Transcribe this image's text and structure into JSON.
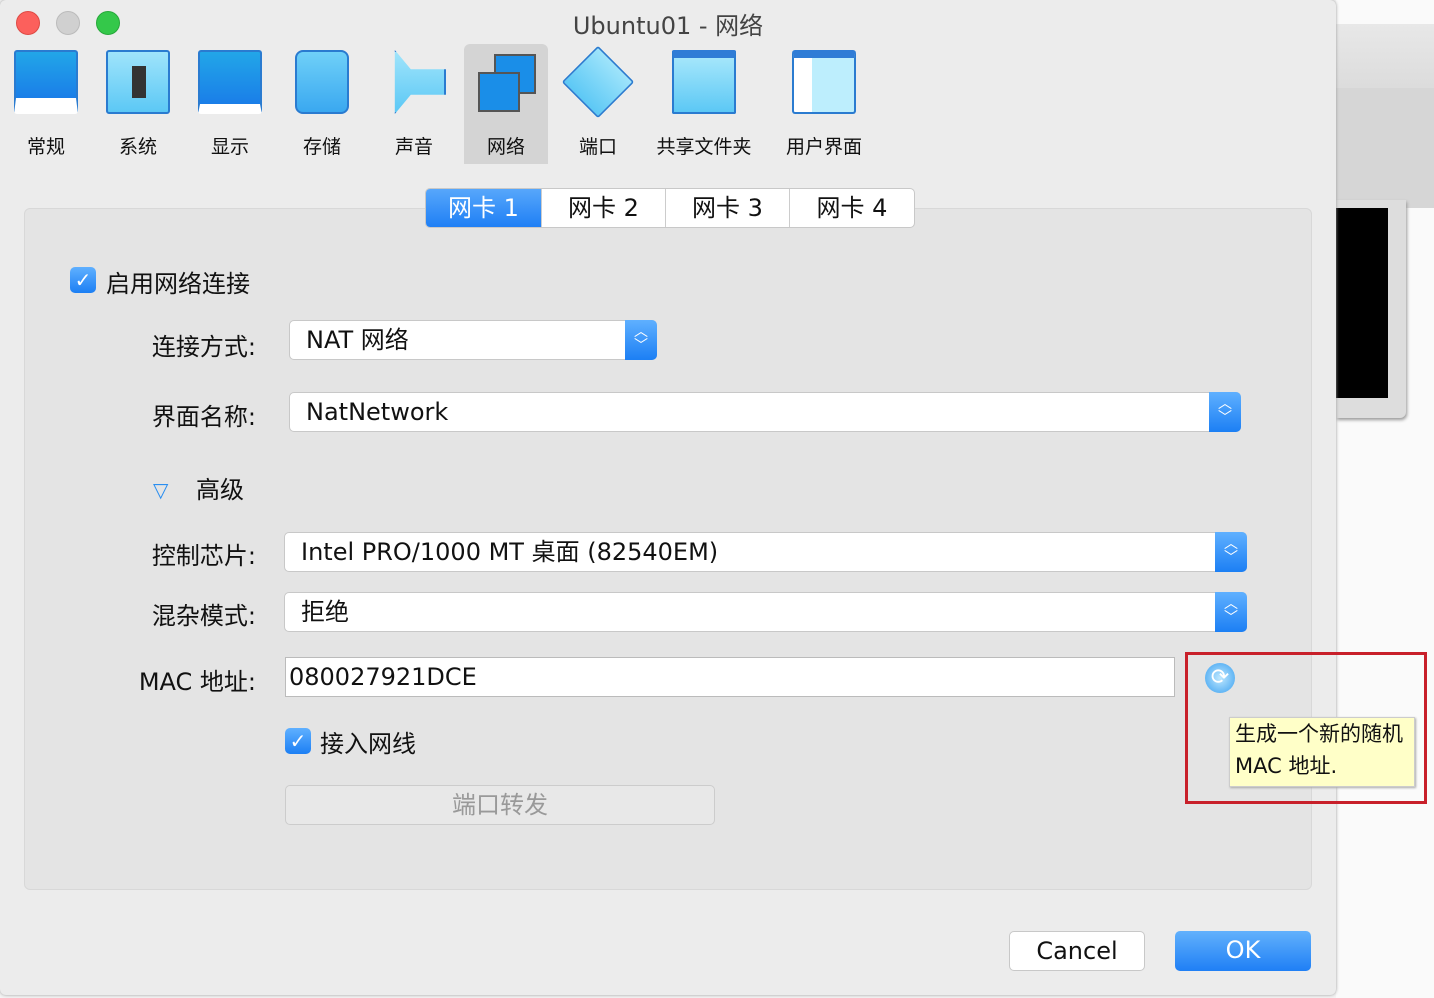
{
  "window": {
    "title": "Ubuntu01 - 网络"
  },
  "toolbar": [
    {
      "label": "常规",
      "icon": "general-icon"
    },
    {
      "label": "系统",
      "icon": "chip-icon"
    },
    {
      "label": "显示",
      "icon": "display-icon"
    },
    {
      "label": "存储",
      "icon": "disk-icon"
    },
    {
      "label": "声音",
      "icon": "speaker-icon"
    },
    {
      "label": "网络",
      "icon": "network-icon"
    },
    {
      "label": "端口",
      "icon": "port-icon"
    },
    {
      "label": "共享文件夹",
      "icon": "folder-icon"
    },
    {
      "label": "用户界面",
      "icon": "ui-icon"
    }
  ],
  "tabs": [
    "网卡 1",
    "网卡 2",
    "网卡 3",
    "网卡 4"
  ],
  "form": {
    "enable_label": "启用网络连接",
    "attach_label": "连接方式:",
    "attach_value": "NAT 网络",
    "name_label": "界面名称:",
    "name_value": "NatNetwork",
    "advanced_label": "高级",
    "adapter_label": "控制芯片:",
    "adapter_value": "Intel PRO/1000 MT 桌面 (82540EM)",
    "promisc_label": "混杂模式:",
    "promisc_value": "拒绝",
    "mac_label": "MAC 地址:",
    "mac_value": "080027921DCE",
    "cable_label": "接入网线",
    "port_forward_label": "端口转发"
  },
  "tooltip": {
    "line1": "生成一个新的随机",
    "line2": "MAC 地址."
  },
  "buttons": {
    "cancel": "Cancel",
    "ok": "OK"
  },
  "colors": {
    "accent": "#1f7ff5",
    "highlight": "#c8202a"
  }
}
